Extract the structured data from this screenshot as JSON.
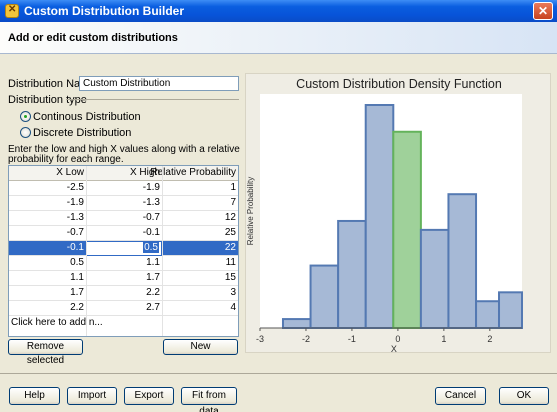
{
  "window": {
    "title": "Custom Distribution Builder"
  },
  "header": {
    "text": "Add or edit custom distributions"
  },
  "form": {
    "name_label": "Distribution Name:",
    "name_value": "Custom Distribution",
    "type_label": "Distribution type",
    "continuous_label": "Continous Distribution",
    "discrete_label": "Discrete Distribution",
    "selected_type": "continuous",
    "instructions_line1": "Enter the low and high X values along with a relative",
    "instructions_line2": "probability for each range."
  },
  "table": {
    "columns": [
      "X Low",
      "X High",
      "Relative Probability"
    ],
    "rows": [
      [
        "-2.5",
        "-1.9",
        "1"
      ],
      [
        "-1.9",
        "-1.3",
        "7"
      ],
      [
        "-1.3",
        "-0.7",
        "12"
      ],
      [
        "-0.7",
        "-0.1",
        "25"
      ],
      [
        "-0.1",
        "0.5",
        "22"
      ],
      [
        "0.5",
        "1.1",
        "11"
      ],
      [
        "1.1",
        "1.7",
        "15"
      ],
      [
        "1.7",
        "2.2",
        "3"
      ],
      [
        "2.2",
        "2.7",
        "4"
      ]
    ],
    "selected_row": 4,
    "add_row_text": "Click here to add n..."
  },
  "buttons": {
    "remove": "Remove selected",
    "new": "New",
    "help": "Help",
    "import": "Import",
    "export": "Export",
    "fit": "Fit from data",
    "cancel": "Cancel",
    "ok": "OK"
  },
  "chart_data": {
    "type": "bar",
    "title": "Custom Distribution Density Function",
    "xlabel": "X",
    "ylabel": "Relative Probability",
    "xlim": [
      -3,
      2.7
    ],
    "ylim": [
      0,
      25
    ],
    "x_ticks": [
      -3,
      -2,
      -1,
      0,
      1,
      2
    ],
    "bins": [
      {
        "low": -2.5,
        "high": -1.9,
        "value": 1
      },
      {
        "low": -1.9,
        "high": -1.3,
        "value": 7
      },
      {
        "low": -1.3,
        "high": -0.7,
        "value": 12
      },
      {
        "low": -0.7,
        "high": -0.1,
        "value": 25
      },
      {
        "low": -0.1,
        "high": 0.5,
        "value": 22
      },
      {
        "low": 0.5,
        "high": 1.1,
        "value": 11
      },
      {
        "low": 1.1,
        "high": 1.7,
        "value": 15
      },
      {
        "low": 1.7,
        "high": 2.2,
        "value": 3
      },
      {
        "low": 2.2,
        "high": 2.7,
        "value": 4
      }
    ],
    "highlighted_bin": 4,
    "colors": {
      "bar_fill": "#a6b9d6",
      "bar_stroke": "#5479b2",
      "highlight_fill": "#9fd19a",
      "highlight_stroke": "#64b35b"
    }
  }
}
